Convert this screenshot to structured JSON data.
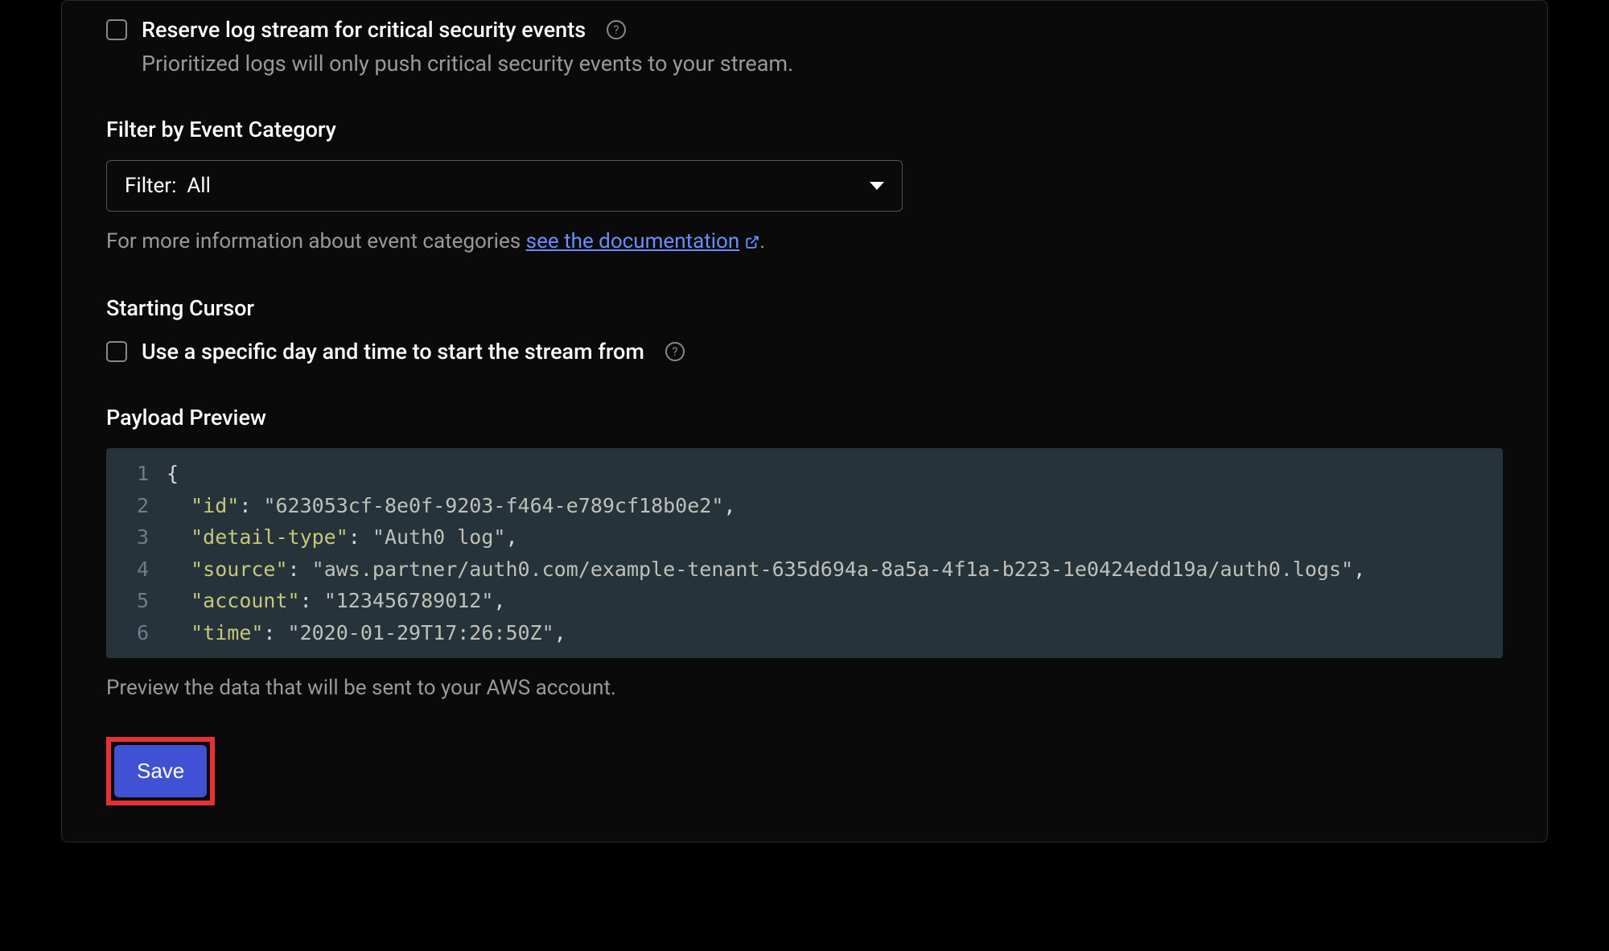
{
  "reserve": {
    "label": "Reserve log stream for critical security events",
    "description": "Prioritized logs will only push critical security events to your stream."
  },
  "filter": {
    "title": "Filter by Event Category",
    "prefix": "Filter:",
    "value": "All",
    "helper_prefix": "For more information about event categories ",
    "link_text": "see the documentation",
    "helper_suffix": "."
  },
  "cursor": {
    "title": "Starting Cursor",
    "label": "Use a specific day and time to start the stream from"
  },
  "payload": {
    "title": "Payload Preview",
    "lines": [
      {
        "num": "1",
        "tokens": [
          {
            "t": "punc",
            "v": "{"
          }
        ]
      },
      {
        "num": "2",
        "tokens": [
          {
            "t": "indent",
            "v": "  "
          },
          {
            "t": "key",
            "v": "\"id\""
          },
          {
            "t": "punc",
            "v": ": "
          },
          {
            "t": "str",
            "v": "\"623053cf-8e0f-9203-f464-e789cf18b0e2\""
          },
          {
            "t": "punc",
            "v": ","
          }
        ]
      },
      {
        "num": "3",
        "tokens": [
          {
            "t": "indent",
            "v": "  "
          },
          {
            "t": "key",
            "v": "\"detail-type\""
          },
          {
            "t": "punc",
            "v": ": "
          },
          {
            "t": "str",
            "v": "\"Auth0 log\""
          },
          {
            "t": "punc",
            "v": ","
          }
        ]
      },
      {
        "num": "4",
        "tokens": [
          {
            "t": "indent",
            "v": "  "
          },
          {
            "t": "key",
            "v": "\"source\""
          },
          {
            "t": "punc",
            "v": ": "
          },
          {
            "t": "str",
            "v": "\"aws.partner/auth0.com/example-tenant-635d694a-8a5a-4f1a-b223-1e0424edd19a/auth0.logs\""
          },
          {
            "t": "punc",
            "v": ","
          }
        ]
      },
      {
        "num": "5",
        "tokens": [
          {
            "t": "indent",
            "v": "  "
          },
          {
            "t": "key",
            "v": "\"account\""
          },
          {
            "t": "punc",
            "v": ": "
          },
          {
            "t": "str",
            "v": "\"123456789012\""
          },
          {
            "t": "punc",
            "v": ","
          }
        ]
      },
      {
        "num": "6",
        "tokens": [
          {
            "t": "indent",
            "v": "  "
          },
          {
            "t": "key",
            "v": "\"time\""
          },
          {
            "t": "punc",
            "v": ": "
          },
          {
            "t": "str",
            "v": "\"2020-01-29T17:26:50Z\""
          },
          {
            "t": "punc",
            "v": ","
          }
        ]
      }
    ],
    "helper": "Preview the data that will be sent to your AWS account."
  },
  "save": {
    "label": "Save"
  }
}
